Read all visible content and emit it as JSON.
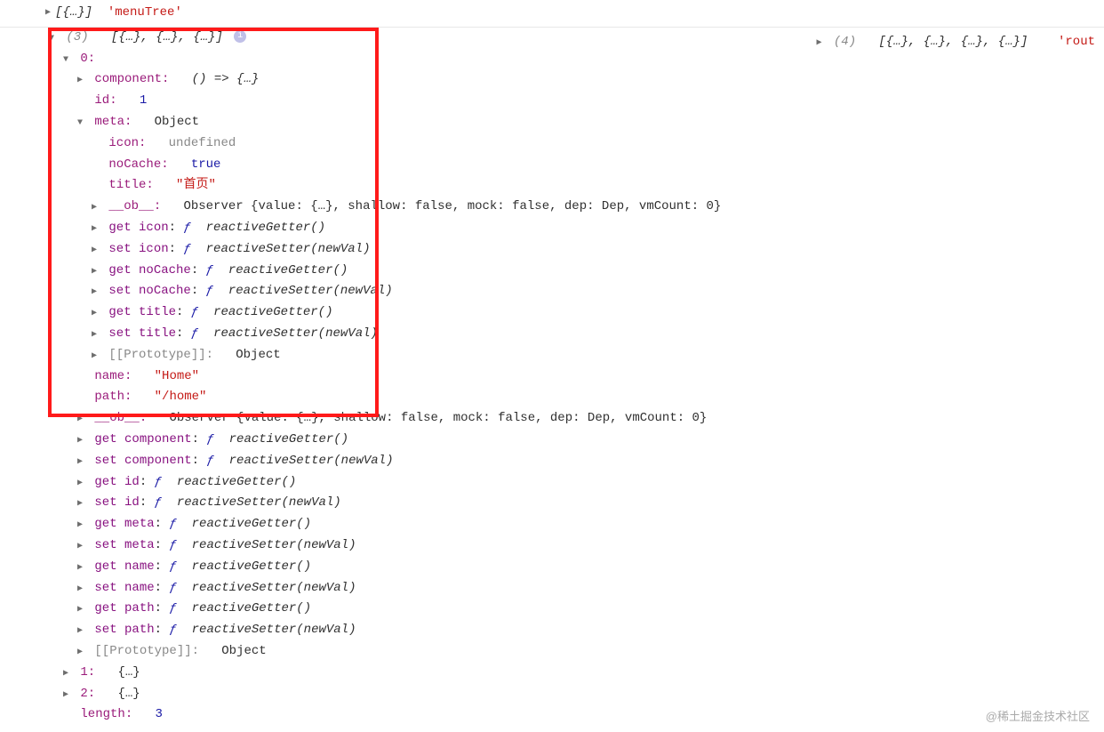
{
  "top": {
    "summary": "[{…}]",
    "label": "'menuTree'"
  },
  "main": {
    "header_count": "(3)",
    "header_summary": "[{…}, {…}, {…}]",
    "idx0": "0:",
    "component_key": "component:",
    "component_val": "() => {…}",
    "id_key": "id:",
    "id_val": "1",
    "meta_key": "meta:",
    "meta_val": "Object",
    "icon_key": "icon:",
    "icon_val": "undefined",
    "noCache_key": "noCache:",
    "noCache_val": "true",
    "title_key": "title:",
    "title_val": "\"首页\"",
    "ob_key": "__ob__:",
    "ob_val": "Observer {value: {…}, shallow: false, mock: false, dep: Dep, vmCount: 0}",
    "get_icon": "get icon",
    "set_icon": "set icon",
    "get_noCache": "get noCache",
    "set_noCache": "set noCache",
    "get_title": "get title",
    "set_title": "set title",
    "reactiveGetter": "reactiveGetter()",
    "reactiveSetter": "reactiveSetter(newVal)",
    "proto_key": "[[Prototype]]:",
    "proto_val": "Object",
    "name_key": "name:",
    "name_val": "\"Home\"",
    "path_key": "path:",
    "path_val": "\"/home\"",
    "get_component": "get component",
    "set_component": "set component",
    "get_id": "get id",
    "set_id": "set id",
    "get_meta": "get meta",
    "set_meta": "set meta",
    "get_name": "get name",
    "set_name": "set name",
    "get_path": "get path",
    "set_path": "set path",
    "idx1": "1:",
    "idx2": "2:",
    "collapsed_obj": "{…}",
    "length_key": "length:",
    "length_val": "3",
    "f": "ƒ",
    "colon_space": ": "
  },
  "right": {
    "count": "(4)",
    "summary": "[{…}, {…}, {…}, {…}]",
    "label": "'rout"
  },
  "watermark": "@稀土掘金技术社区"
}
